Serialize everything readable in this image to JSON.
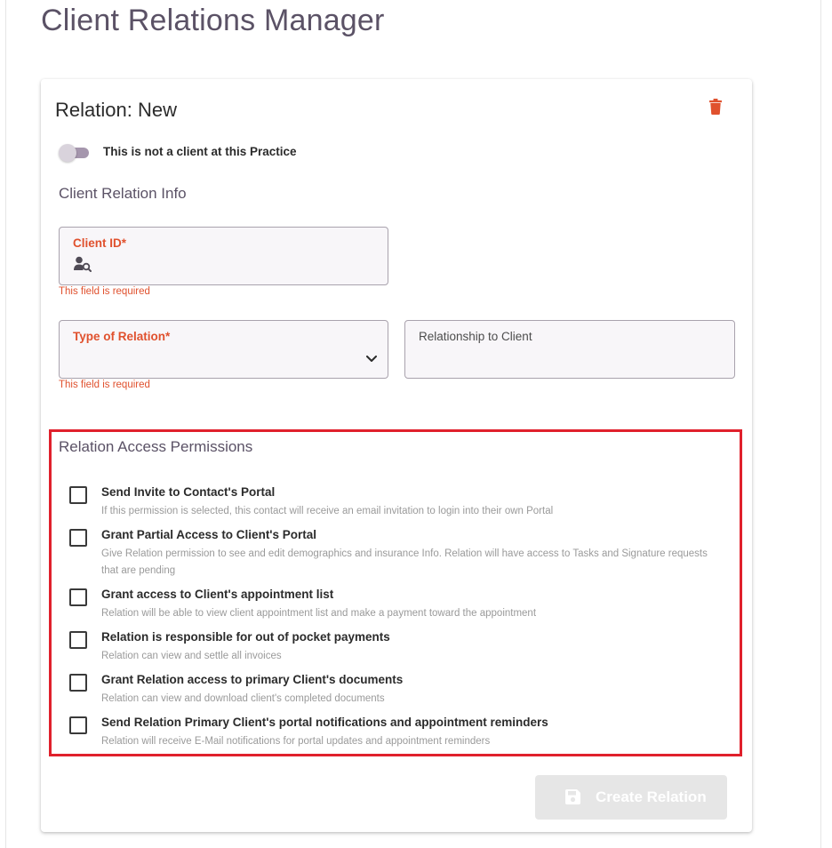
{
  "page": {
    "title": "Client Relations Manager"
  },
  "card": {
    "title": "Relation: New",
    "not_client_toggle_label": "This is not a client at this Practice",
    "info_heading": "Client Relation Info",
    "client_id": {
      "label": "Client ID*",
      "value": "",
      "error": "This field is required"
    },
    "type_of_relation": {
      "label": "Type of Relation*",
      "value": "",
      "error": "This field is required"
    },
    "relationship_to_client": {
      "label": "Relationship to Client",
      "value": ""
    },
    "permissions_heading": "Relation Access Permissions",
    "permissions": [
      {
        "title": "Send Invite to Contact's Portal",
        "description": "If this permission is selected, this contact will receive an email invitation to login into their own Portal",
        "checked": false
      },
      {
        "title": "Grant Partial Access to Client's Portal",
        "description": "Give Relation permission to see and edit demographics and insurance Info. Relation will have access to Tasks and Signature requests that are pending",
        "checked": false
      },
      {
        "title": "Grant access to Client's appointment list",
        "description": "Relation will be able to view client appointment list and make a payment toward the appointment",
        "checked": false
      },
      {
        "title": "Relation is responsible for out of pocket payments",
        "description": "Relation can view and settle all invoices",
        "checked": false
      },
      {
        "title": "Grant Relation access to primary Client's documents",
        "description": "Relation can view and download client's completed documents",
        "checked": false
      },
      {
        "title": "Send Relation Primary Client's portal notifications and appointment reminders",
        "description": "Relation will receive E-Mail notifications for portal updates and appointment reminders",
        "checked": false
      }
    ],
    "create_button_label": "Create Relation"
  },
  "icons": {
    "delete": "trash-icon",
    "client_search": "person-search-icon",
    "dropdown": "chevron-down-icon",
    "save": "floppy-disk-icon"
  },
  "colors": {
    "title": "#5b5266",
    "required": "#e0512e",
    "trash": "#e0512e",
    "highlight_border": "#e0202c",
    "button_disabled_bg": "#e6e6e6"
  }
}
